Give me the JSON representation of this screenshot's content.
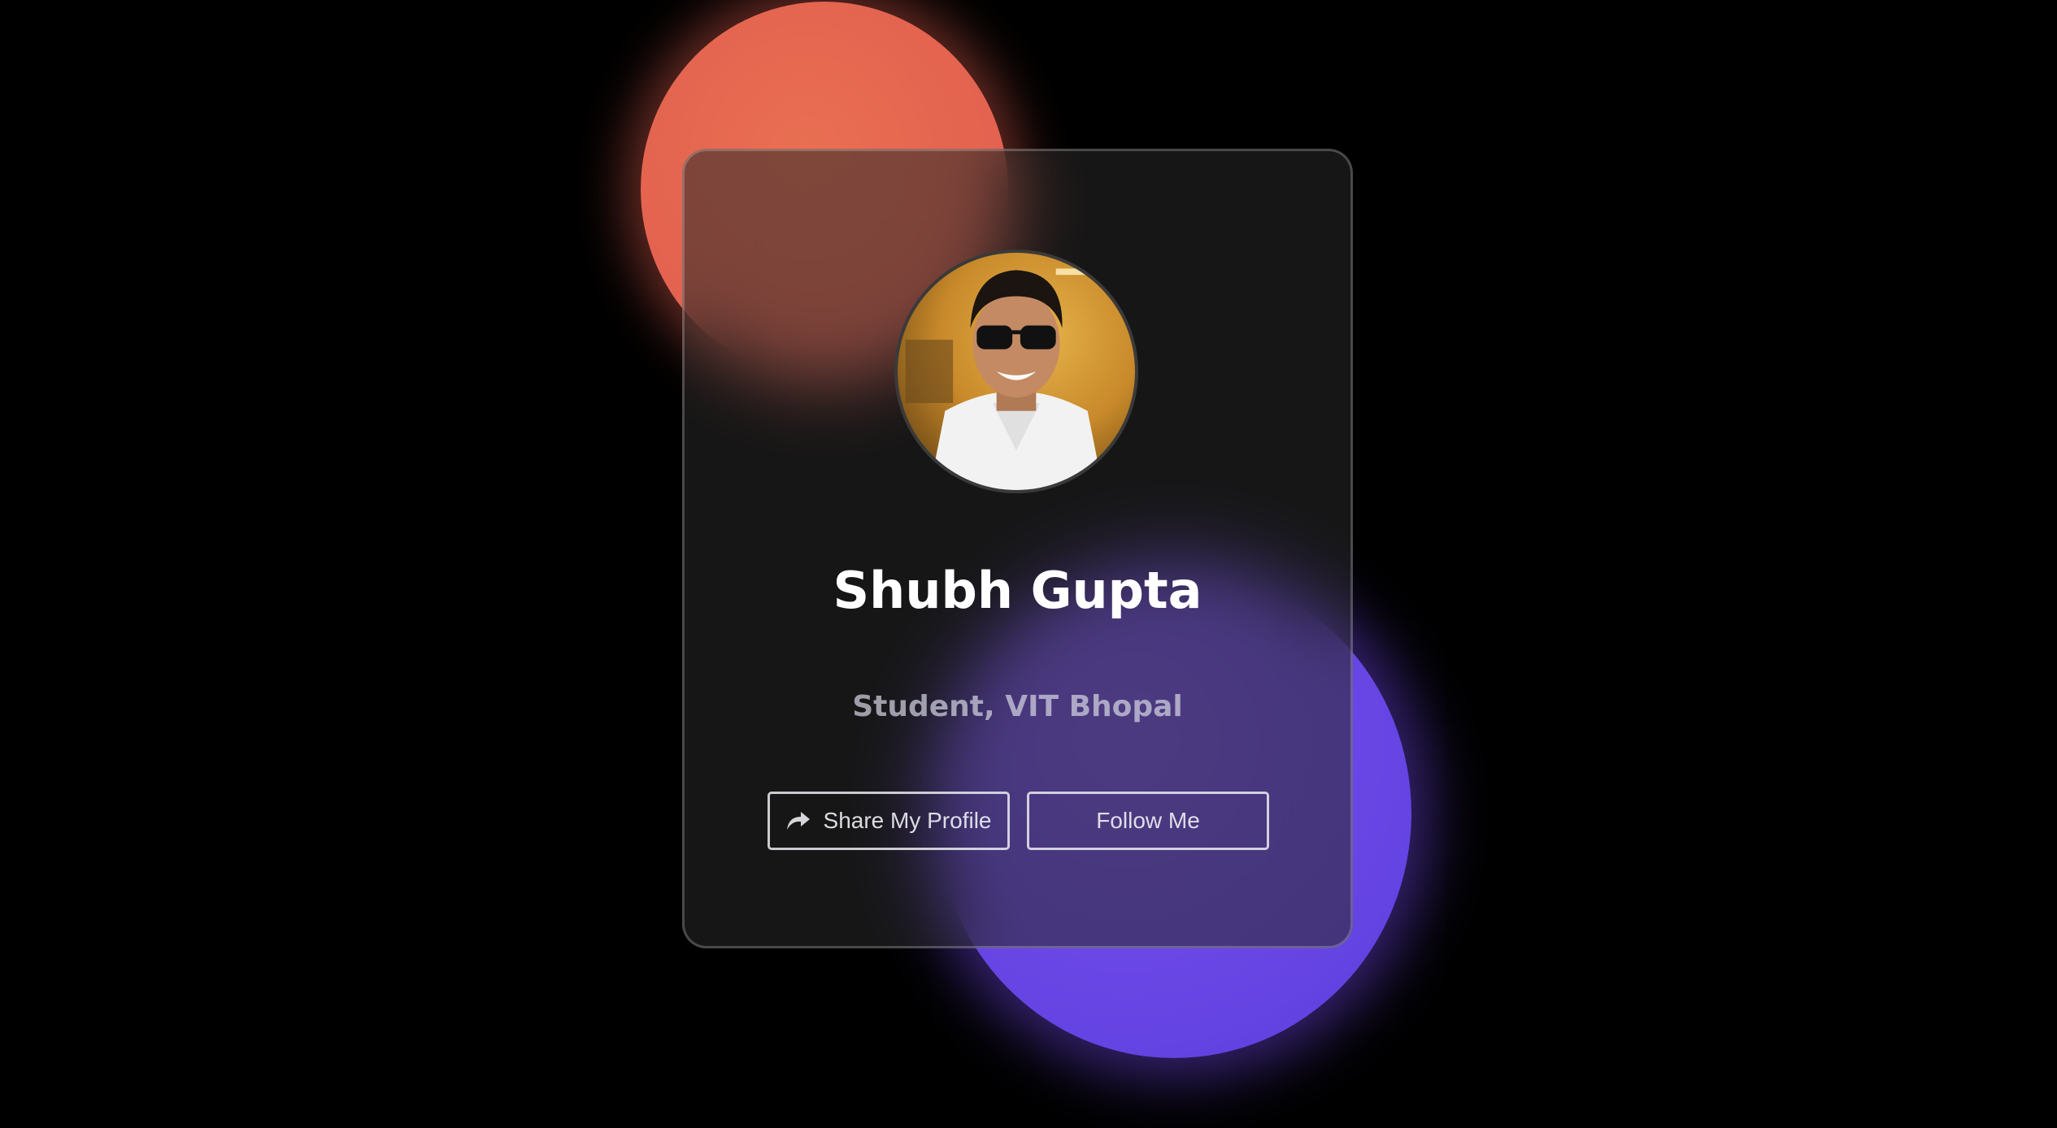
{
  "profile": {
    "name": "Shubh Gupta",
    "role": "Student, VIT Bhopal"
  },
  "buttons": {
    "share_label": "Share My Profile",
    "follow_label": "Follow Me"
  },
  "icons": {
    "share": "share-arrow-icon"
  },
  "colors": {
    "background": "#000000",
    "coral_blob": "#e4644f",
    "purple_blob": "#6a47e6",
    "card": "#1c1c1c"
  }
}
